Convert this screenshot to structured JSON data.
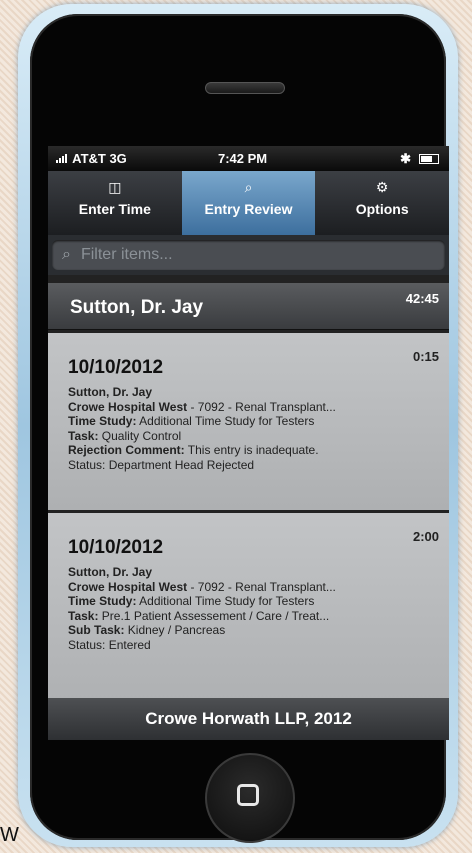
{
  "status_bar": {
    "carrier": "AT&T  3G",
    "time": "7:42 PM"
  },
  "tabs": [
    {
      "label": "Enter Time",
      "icon": "list-icon"
    },
    {
      "label": "Entry Review",
      "icon": "search-icon",
      "active": true
    },
    {
      "label": "Options",
      "icon": "gear-icon"
    }
  ],
  "filter": {
    "placeholder": "Filter items..."
  },
  "header": {
    "name": "Sutton, Dr. Jay",
    "total": "42:45"
  },
  "entries": [
    {
      "date": "10/10/2012",
      "duration": "0:15",
      "person": "Sutton, Dr. Jay",
      "location_bold": "Crowe Hospital West",
      "location_rest": " - 7092 - Renal Transplant...",
      "study_label": "Time Study:",
      "study_value": " Additional Time Study for Testers",
      "task_label": "Task:",
      "task_value": " Quality Control",
      "rejection_label": "Rejection Comment:",
      "rejection_value": " This entry is inadequate.",
      "status": "Status: Department Head Rejected"
    },
    {
      "date": "10/10/2012",
      "duration": "2:00",
      "person": "Sutton, Dr. Jay",
      "location_bold": "Crowe Hospital West",
      "location_rest": " - 7092 - Renal Transplant...",
      "study_label": "Time Study:",
      "study_value": " Additional Time Study for Testers",
      "task_label": "Task:",
      "task_value": " Pre.1 Patient Assessement / Care / Treat...",
      "subtask_label": "Sub Task:",
      "subtask_value": " Kidney / Pancreas",
      "status": "Status: Entered"
    }
  ],
  "footer": {
    "text": "Crowe Horwath LLP, 2012"
  },
  "corner_text": "W",
  "colors": {
    "active_tab": "#5a8ab8",
    "entry_bg": "#b8babc"
  }
}
